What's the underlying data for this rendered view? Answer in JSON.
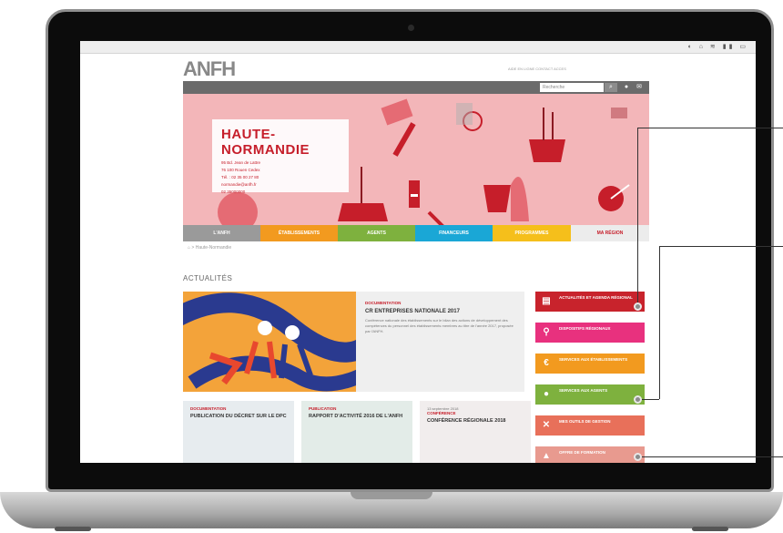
{
  "browser": {
    "status_icons": "◐ ⌂ ≋ ▮▮ ▭"
  },
  "site": {
    "logo": "ANFH",
    "top_links": "AIDE EN LIGNE   CONTACT   ACCES",
    "search_placeholder": "Recherche",
    "search_icon": "search-icon"
  },
  "banner": {
    "region_name": "HAUTE-NORMANDIE",
    "address_lines": [
      "95 Bd. Jean de Lattre",
      "76 100 Rouen Cedex",
      "Tél. : 02 35 00 27 80",
      "normandie@anfh.fr",
      "02 35000000"
    ]
  },
  "nav": {
    "items": [
      {
        "label": "L'ANFH",
        "color": "#9a9a9a"
      },
      {
        "label": "ÉTABLISSEMENTS",
        "color": "#f29a1f"
      },
      {
        "label": "AGENTS",
        "color": "#7eb13e"
      },
      {
        "label": "FINANCEURS",
        "color": "#1aa7d6"
      },
      {
        "label": "PROGRAMMES",
        "color": "#f5bf1b"
      },
      {
        "label": "MA RÉGION",
        "color": "#ececec"
      }
    ]
  },
  "breadcrumb": "⌂  >  Haute-Normandie",
  "main": {
    "section_title": "ACTUALITÉS",
    "feature": {
      "kicker": "DOCUMENTATION",
      "title": "CR ENTREPRISES NATIONALE 2017",
      "body": "Conférence nationale des établissements sur le bilan des actions de développement des compétences du personnel des établissements membres au titre de l'année 2017, proposée par l'ANFH."
    },
    "cards": [
      {
        "kicker": "DOCUMENTATION",
        "title": "PUBLICATION DU DÉCRET SUR LE DPC",
        "date": ""
      },
      {
        "kicker": "PUBLICATION",
        "title": "RAPPORT D'ACTIVITÉ 2016 DE L'ANFH",
        "date": ""
      },
      {
        "kicker": "CONFÉRENCE",
        "title": "CONFÉRENCE RÉGIONALE 2018",
        "date": "13 septembre 2018"
      }
    ]
  },
  "sidebar": {
    "items": [
      {
        "label": "ACTUALITÉS ET AGENDA RÉGIONAL",
        "color": "#c8232c",
        "icon": "calendar-icon"
      },
      {
        "label": "DISPOSITIFS RÉGIONAUX",
        "color": "#e8317e",
        "icon": "key-icon"
      },
      {
        "label": "SERVICES AUX ÉTABLISSEMENTS",
        "color": "#f29a1f",
        "icon": "euro-icon"
      },
      {
        "label": "SERVICES AUX AGENTS",
        "color": "#7eb13e",
        "icon": "person-icon"
      },
      {
        "label": "MES OUTILS DE GESTION",
        "color": "#e8705a",
        "icon": "tools-icon"
      },
      {
        "label": "OFFRE DE FORMATION",
        "color": "#e89a8f",
        "icon": "graduation-icon"
      }
    ]
  }
}
